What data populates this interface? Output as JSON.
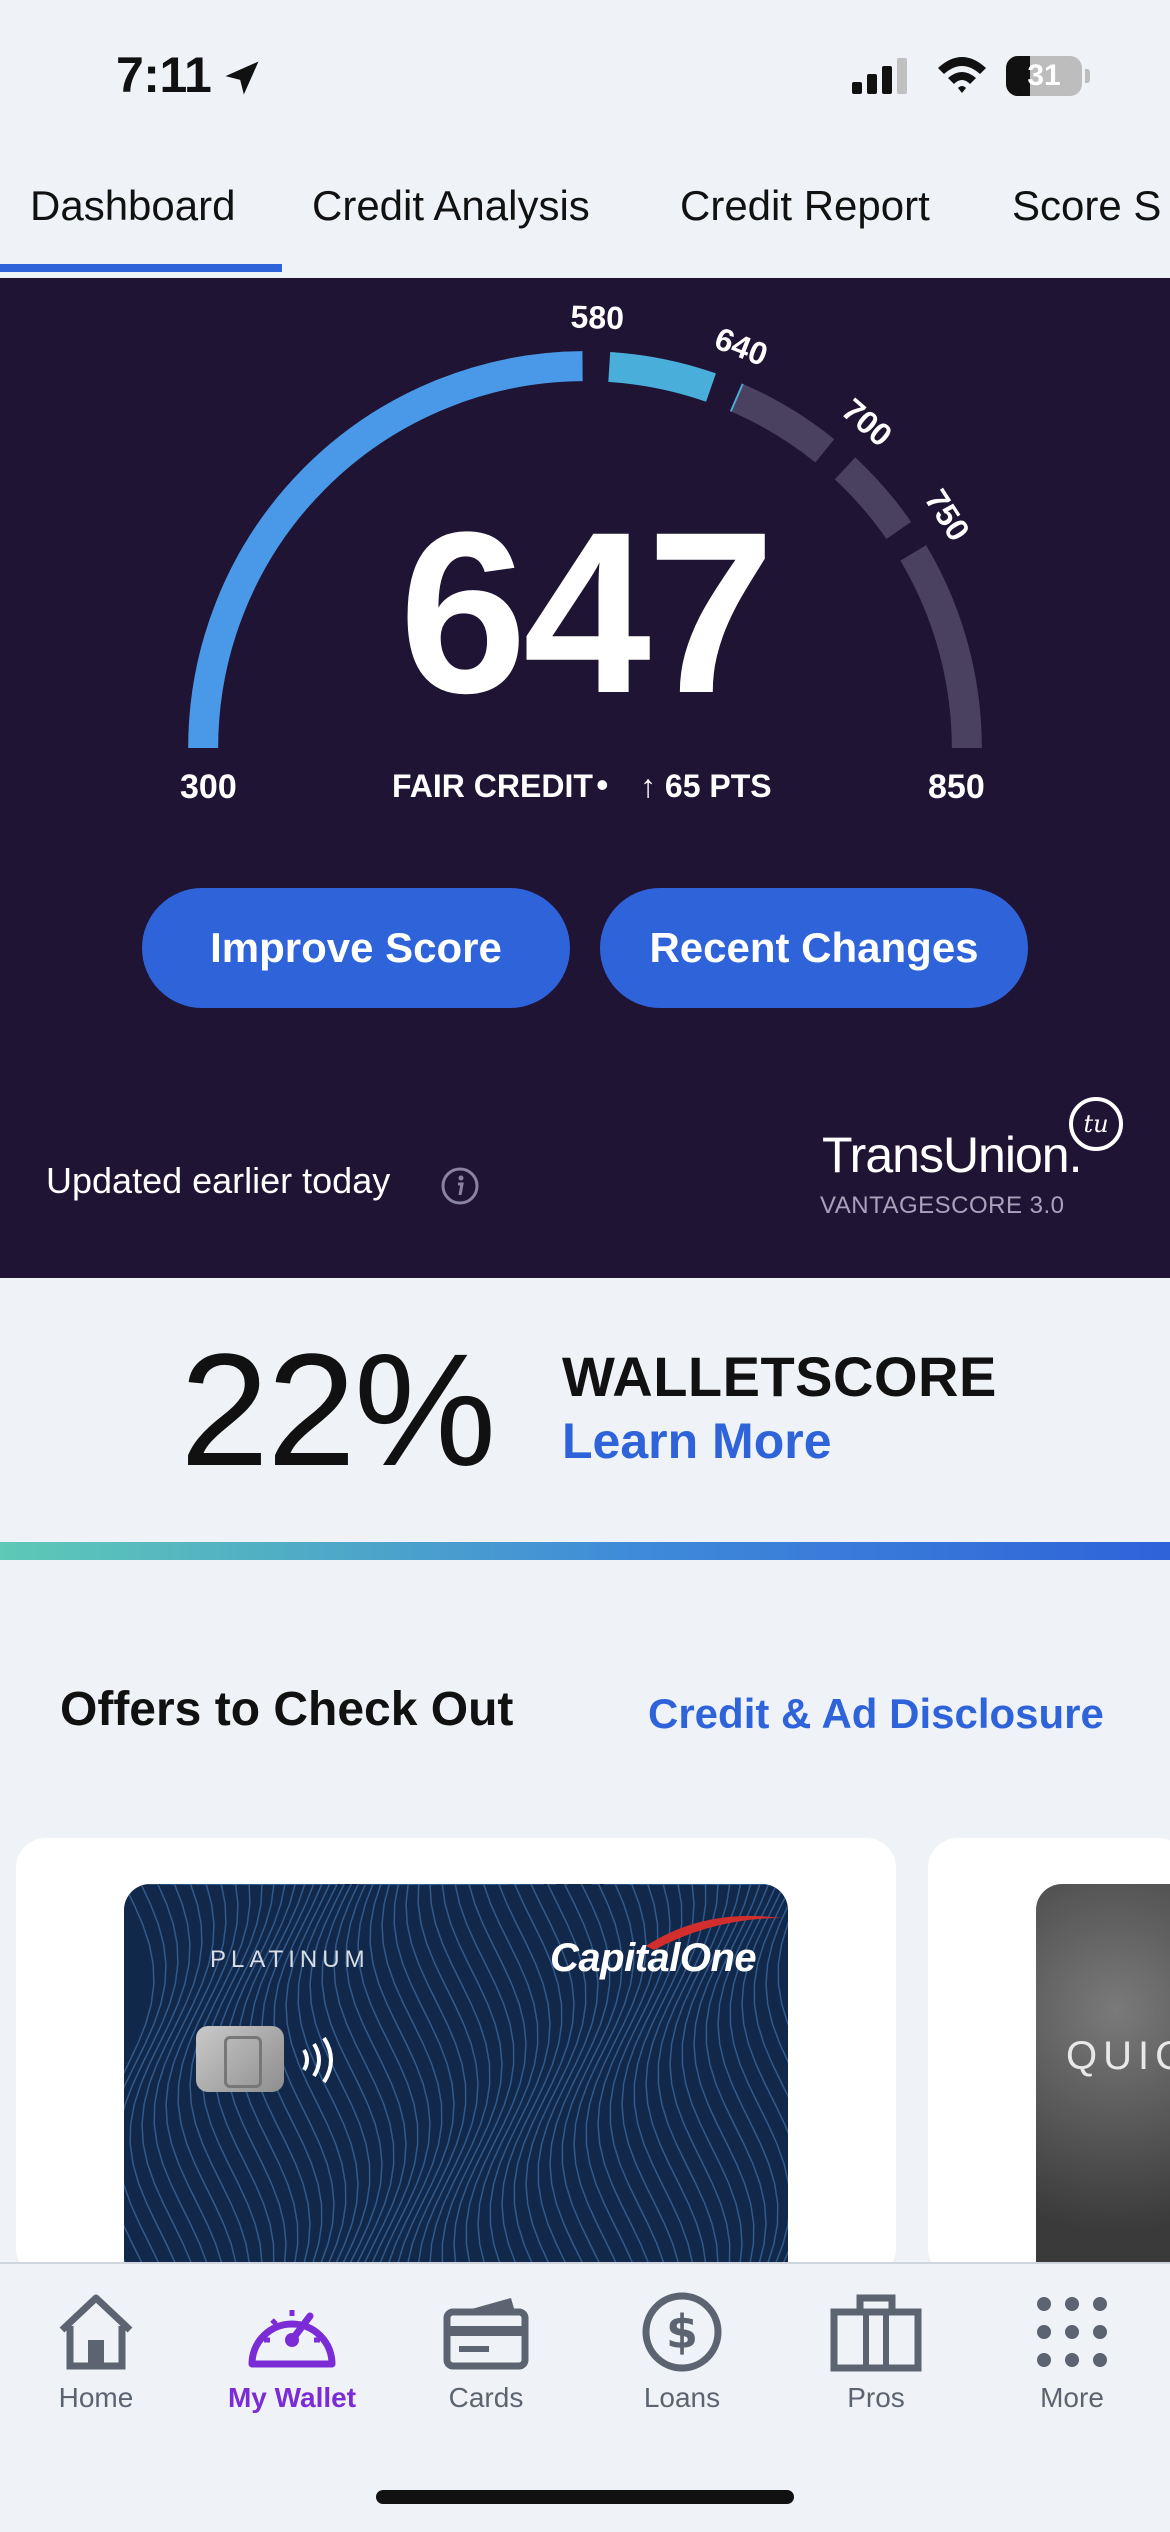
{
  "status_bar": {
    "time": "7:11",
    "battery": "31",
    "battery_level": 0.31,
    "icons": [
      "location-arrow-icon",
      "signal-icon",
      "wifi-icon",
      "battery-icon"
    ]
  },
  "tabs": [
    {
      "label": "Dashboard",
      "active": true
    },
    {
      "label": "Credit Analysis",
      "active": false
    },
    {
      "label": "Credit Report",
      "active": false
    },
    {
      "label": "Score S",
      "active": false
    }
  ],
  "score": {
    "value": "647",
    "rating": "FAIR CREDIT",
    "separator": "•",
    "change": "↑ 65 PTS",
    "gauge_min": "300",
    "gauge_max": "850",
    "gauge_markers": [
      "580",
      "640",
      "700",
      "750"
    ],
    "score_number": 647,
    "range": [
      300,
      850
    ],
    "segments": [
      {
        "from": 300,
        "to": 580,
        "color": "#4a98e8"
      },
      {
        "from": 580,
        "to": 640,
        "color": "#4aaedb"
      },
      {
        "from": 640,
        "to": 700,
        "color": "#4a4060"
      },
      {
        "from": 700,
        "to": 750,
        "color": "#4a4060"
      },
      {
        "from": 750,
        "to": 850,
        "color": "#4a4060"
      }
    ],
    "improve_button": "Improve Score",
    "recent_button": "Recent Changes",
    "updated_text": "Updated earlier today",
    "bureau": "TransUnion.",
    "bureau_logo_text": "tu",
    "model": "VANTAGESCORE 3.0"
  },
  "walletscore": {
    "percent": "22%",
    "title": "WALLETSCORE",
    "link": "Learn More"
  },
  "offers": {
    "title": "Offers to Check Out",
    "disclosure": "Credit & Ad Disclosure",
    "cards": [
      {
        "tier": "PLATINUM",
        "brand": "CapitalOne"
      },
      {
        "brand": "QUIC"
      }
    ]
  },
  "nav": [
    {
      "label": "Home",
      "icon": "home-icon",
      "active": false
    },
    {
      "label": "My Wallet",
      "icon": "speedometer-icon",
      "active": true
    },
    {
      "label": "Cards",
      "icon": "credit-card-icon",
      "active": false
    },
    {
      "label": "Loans",
      "icon": "dollar-circle-icon",
      "active": false
    },
    {
      "label": "Pros",
      "icon": "briefcase-icon",
      "active": false
    },
    {
      "label": "More",
      "icon": "grid-dots-icon",
      "active": false
    }
  ],
  "colors": {
    "accent": "#2f63d9",
    "panel": "#1f1433",
    "active_nav": "#7b2cd6"
  }
}
